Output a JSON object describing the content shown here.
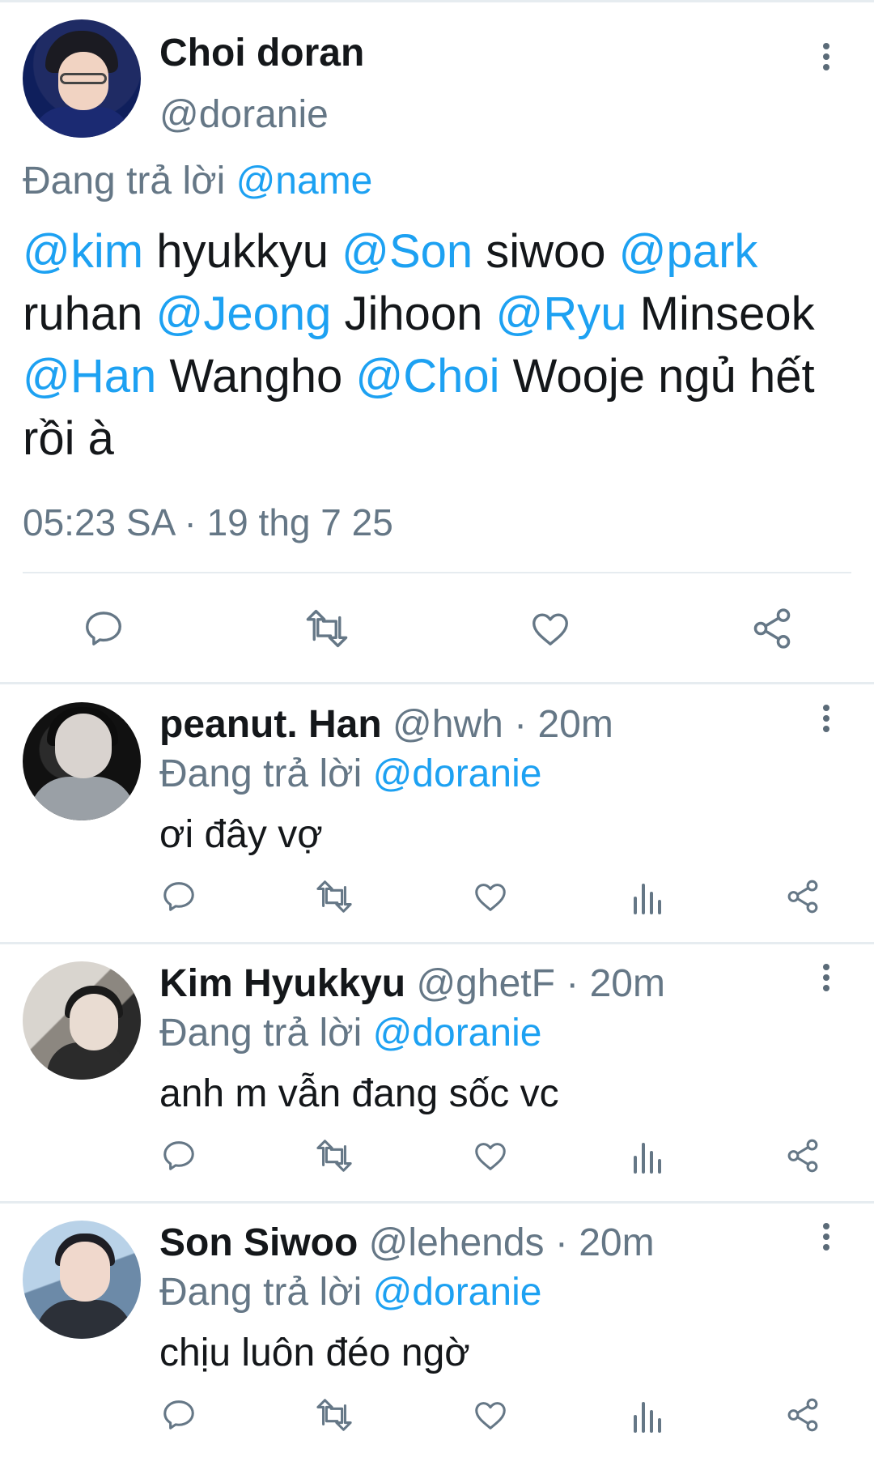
{
  "main_tweet": {
    "display_name": "Choi doran",
    "handle": "@doranie",
    "replying_prefix": "Đang trả lời ",
    "replying_to": "@name",
    "text_segments": [
      {
        "t": "@kim",
        "m": true
      },
      {
        "t": " hyukkyu ",
        "m": false
      },
      {
        "t": "@Son",
        "m": true
      },
      {
        "t": " siwoo ",
        "m": false
      },
      {
        "t": "@park",
        "m": true
      },
      {
        "t": " ruhan ",
        "m": false
      },
      {
        "t": "@Jeong",
        "m": true
      },
      {
        "t": " Jihoon ",
        "m": false
      },
      {
        "t": "@Ryu",
        "m": true
      },
      {
        "t": " Minseok ",
        "m": false
      },
      {
        "t": "@Han",
        "m": true
      },
      {
        "t": " Wangho ",
        "m": false
      },
      {
        "t": "@Choi",
        "m": true
      },
      {
        "t": " Wooje ngủ hết rồi à",
        "m": false
      }
    ],
    "timestamp": "05:23 SA · 19 thg 7 25"
  },
  "replies": [
    {
      "display_name": "peanut. Han",
      "handle": "@hwh",
      "time": "20m",
      "replying_prefix": "Đang trả lời ",
      "replying_to": "@doranie",
      "text": "ơi đây vợ"
    },
    {
      "display_name": "Kim Hyukkyu",
      "handle": "@ghetF",
      "time": "20m",
      "replying_prefix": "Đang trả lời ",
      "replying_to": "@doranie",
      "text": "anh m vẫn đang sốc vc"
    },
    {
      "display_name": "Son Siwoo",
      "handle": "@lehends",
      "time": "20m",
      "replying_prefix": "Đang trả lời ",
      "replying_to": "@doranie",
      "text": "chịu luôn đéo ngờ"
    }
  ],
  "icons": {
    "reply": "speech-bubble-icon",
    "retweet": "retweet-icon",
    "like": "heart-icon",
    "views": "bar-chart-icon",
    "share": "share-icon",
    "more": "vertical-dots-icon"
  },
  "colors": {
    "mention": "#1da1f2",
    "secondary_text": "#657786",
    "divider": "#e6ecf0"
  }
}
